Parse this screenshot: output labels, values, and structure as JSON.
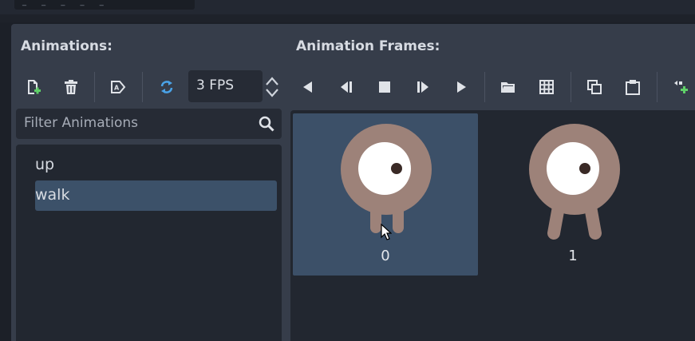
{
  "top_field": {
    "text": "_ _ _ _ _"
  },
  "animations_panel": {
    "title": "Animations:",
    "filter_placeholder": "Filter Animations",
    "fps_value": "3 FPS",
    "items": [
      {
        "label": "up",
        "selected": false
      },
      {
        "label": "walk",
        "selected": true
      }
    ]
  },
  "frames_panel": {
    "title": "Animation Frames:",
    "frames": [
      {
        "label": "0",
        "selected": true
      },
      {
        "label": "1",
        "selected": false
      }
    ]
  },
  "toolbar_icons": [
    "new-animation-icon",
    "delete-animation-icon",
    "autoplay-icon",
    "loop-icon",
    "play-backwards-icon",
    "play-backwards-from-end-icon",
    "stop-icon",
    "play-from-start-icon",
    "play-icon",
    "load-sheet-icon",
    "grid-icon",
    "copy-icon",
    "paste-icon",
    "insert-frame-icon"
  ],
  "colors": {
    "accent": "#4aa3e8",
    "selection": "#3c5169",
    "sprite_body": "#9d8279"
  }
}
